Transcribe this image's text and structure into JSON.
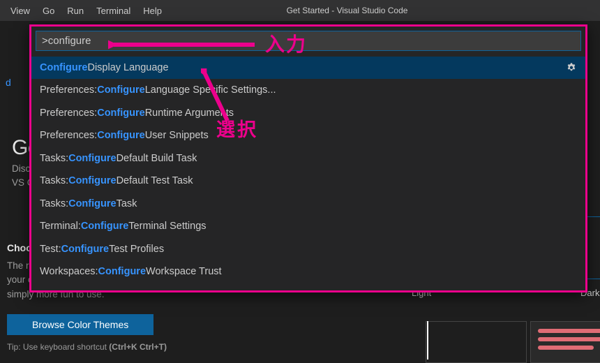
{
  "menubar": {
    "items": [
      "View",
      "Go",
      "Run",
      "Terminal",
      "Help"
    ],
    "windowTitle": "Get Started - Visual Studio Code"
  },
  "left_fragment": "d",
  "welcome": {
    "title_frag": "Ge",
    "sub_line1": "Disc",
    "sub_line2": "VS C"
  },
  "theme": {
    "title": "Choose the look you want",
    "desc_line1": "The right color palette helps you focus on",
    "desc_line2": "your code, is easy on your eyes, and is",
    "desc_line3": "simply more fun to use.",
    "button": "Browse Color Themes",
    "tip_prefix": "Tip: Use keyboard shortcut ",
    "tip_kbd": "(Ctrl+K Ctrl+T)",
    "preview": {
      "light": "Light",
      "dark": "Dark"
    }
  },
  "palette": {
    "input": ">configure",
    "items": [
      {
        "hl": "Configure",
        "rest": " Display Language",
        "selected": true,
        "gear": true
      },
      {
        "prefix": "Preferences: ",
        "hl": "Configure",
        "rest": " Language Specific Settings..."
      },
      {
        "prefix": "Preferences: ",
        "hl": "Configure",
        "rest": " Runtime Arguments"
      },
      {
        "prefix": "Preferences: ",
        "hl": "Configure",
        "rest": " User Snippets"
      },
      {
        "prefix": "Tasks: ",
        "hl": "Configure",
        "rest": " Default Build Task"
      },
      {
        "prefix": "Tasks: ",
        "hl": "Configure",
        "rest": " Default Test Task"
      },
      {
        "prefix": "Tasks: ",
        "hl": "Configure",
        "rest": " Task"
      },
      {
        "prefix": "Terminal: ",
        "hl": "Configure",
        "rest": " Terminal Settings"
      },
      {
        "prefix": "Test: ",
        "hl": "Configure",
        "rest": " Test Profiles"
      },
      {
        "prefix": "Workspaces: ",
        "hl": "Configure",
        "rest": " Workspace Trust"
      }
    ]
  },
  "annotations": {
    "input_label": "入力",
    "select_label": "選択",
    "color": "#ec008c"
  }
}
